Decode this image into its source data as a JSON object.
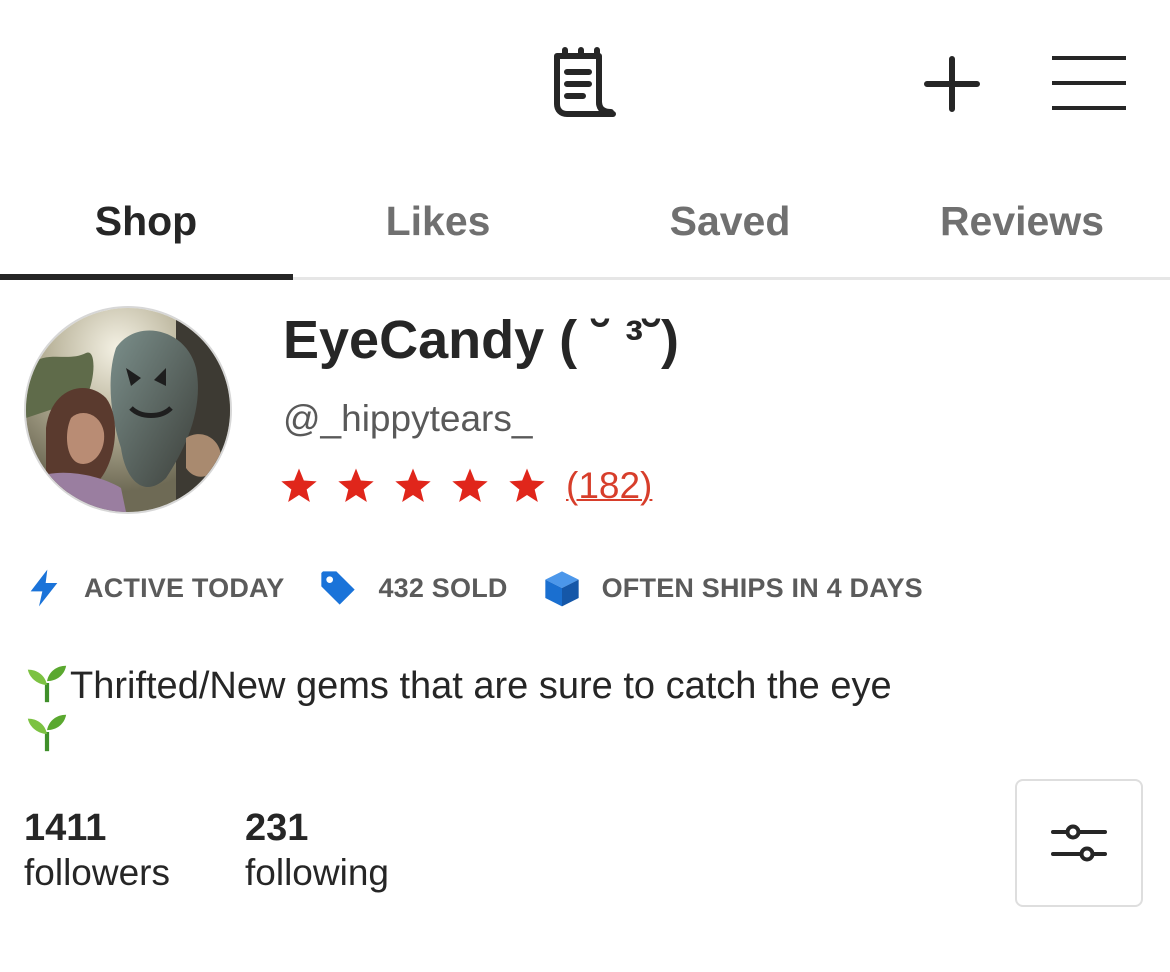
{
  "header": {
    "icons": [
      "receipt-icon",
      "plus-icon",
      "menu-icon"
    ]
  },
  "tabs": [
    {
      "label": "Shop",
      "active": true
    },
    {
      "label": "Likes",
      "active": false
    },
    {
      "label": "Saved",
      "active": false
    },
    {
      "label": "Reviews",
      "active": false
    }
  ],
  "profile": {
    "shop_name": "EyeCandy ( ˘ ³˘)",
    "handle": "@_hippytears_",
    "rating": 5,
    "review_count": "(182)"
  },
  "badges": [
    {
      "icon": "lightning-icon",
      "text": "ACTIVE TODAY"
    },
    {
      "icon": "tag-icon",
      "text": "432 SOLD"
    },
    {
      "icon": "box-icon",
      "text": "OFTEN SHIPS IN 4 DAYS"
    }
  ],
  "bio": {
    "text": "Thrifted/New gems that are sure to catch the eye"
  },
  "stats": {
    "followers_count": "1411",
    "followers_label": "followers",
    "following_count": "231",
    "following_label": "following"
  },
  "colors": {
    "star": "#e0261b",
    "review_link": "#d73e2b",
    "badge_icon": "#1a73d9",
    "tab_active": "#262626",
    "tab_inactive": "#707070"
  }
}
